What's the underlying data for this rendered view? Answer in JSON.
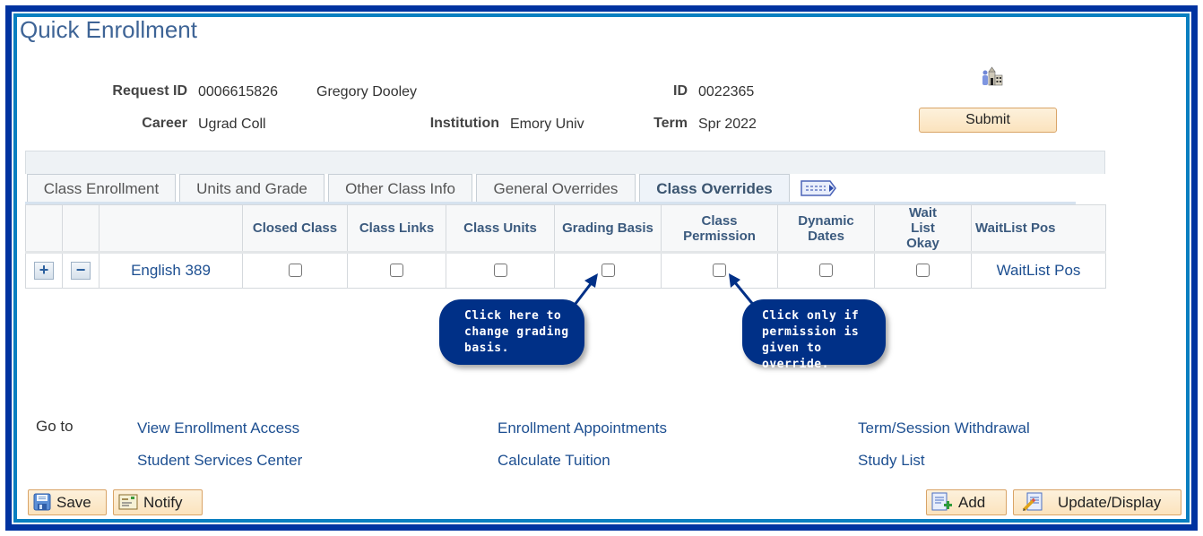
{
  "page": {
    "title": "Quick Enrollment"
  },
  "header": {
    "request_id_label": "Request ID",
    "request_id": "0006615826",
    "student_name": "Gregory Dooley",
    "id_label": "ID",
    "id": "0022365",
    "career_label": "Career",
    "career": "Ugrad Coll",
    "institution_label": "Institution",
    "institution": "Emory Univ",
    "term_label": "Term",
    "term": "Spr 2022",
    "submit_label": "Submit"
  },
  "tabs": [
    {
      "label": "Class Enrollment",
      "active": false
    },
    {
      "label": "Units and Grade",
      "active": false
    },
    {
      "label": "Other Class Info",
      "active": false
    },
    {
      "label": "General Overrides",
      "active": false
    },
    {
      "label": "Class Overrides",
      "active": true
    }
  ],
  "table": {
    "columns": [
      "",
      "",
      "",
      "Closed Class",
      "Class Links",
      "Class Units",
      "Grading Basis",
      "Class Permission",
      "Dynamic Dates",
      "Wait List Okay",
      "WaitList Pos"
    ],
    "rows": [
      {
        "add_icon": "+",
        "remove_icon": "−",
        "class_name": "English 389",
        "closed_class": false,
        "class_links": false,
        "class_units": false,
        "grading_basis": false,
        "class_permission": false,
        "dynamic_dates": false,
        "wait_list_okay": false,
        "waitlist_pos": "WaitList Pos"
      }
    ]
  },
  "callouts": {
    "grading": [
      "Click here to",
      "change grading",
      "basis."
    ],
    "permission": [
      "Click only if",
      "permission is",
      "given to override."
    ]
  },
  "goto": {
    "label": "Go to",
    "links": [
      "View Enrollment Access",
      "Enrollment Appointments",
      "Term/Session Withdrawal",
      "Student Services Center",
      "Calculate Tuition",
      "Study List"
    ]
  },
  "toolbar": {
    "save_label": "Save",
    "notify_label": "Notify",
    "add_label": "Add",
    "update_label": "Update/Display"
  },
  "colors": {
    "frame_outer": "#0033a0",
    "frame_inner": "#0a7fc0",
    "link": "#1d4f91",
    "callout": "#003087",
    "button": "#fbe3bd"
  }
}
